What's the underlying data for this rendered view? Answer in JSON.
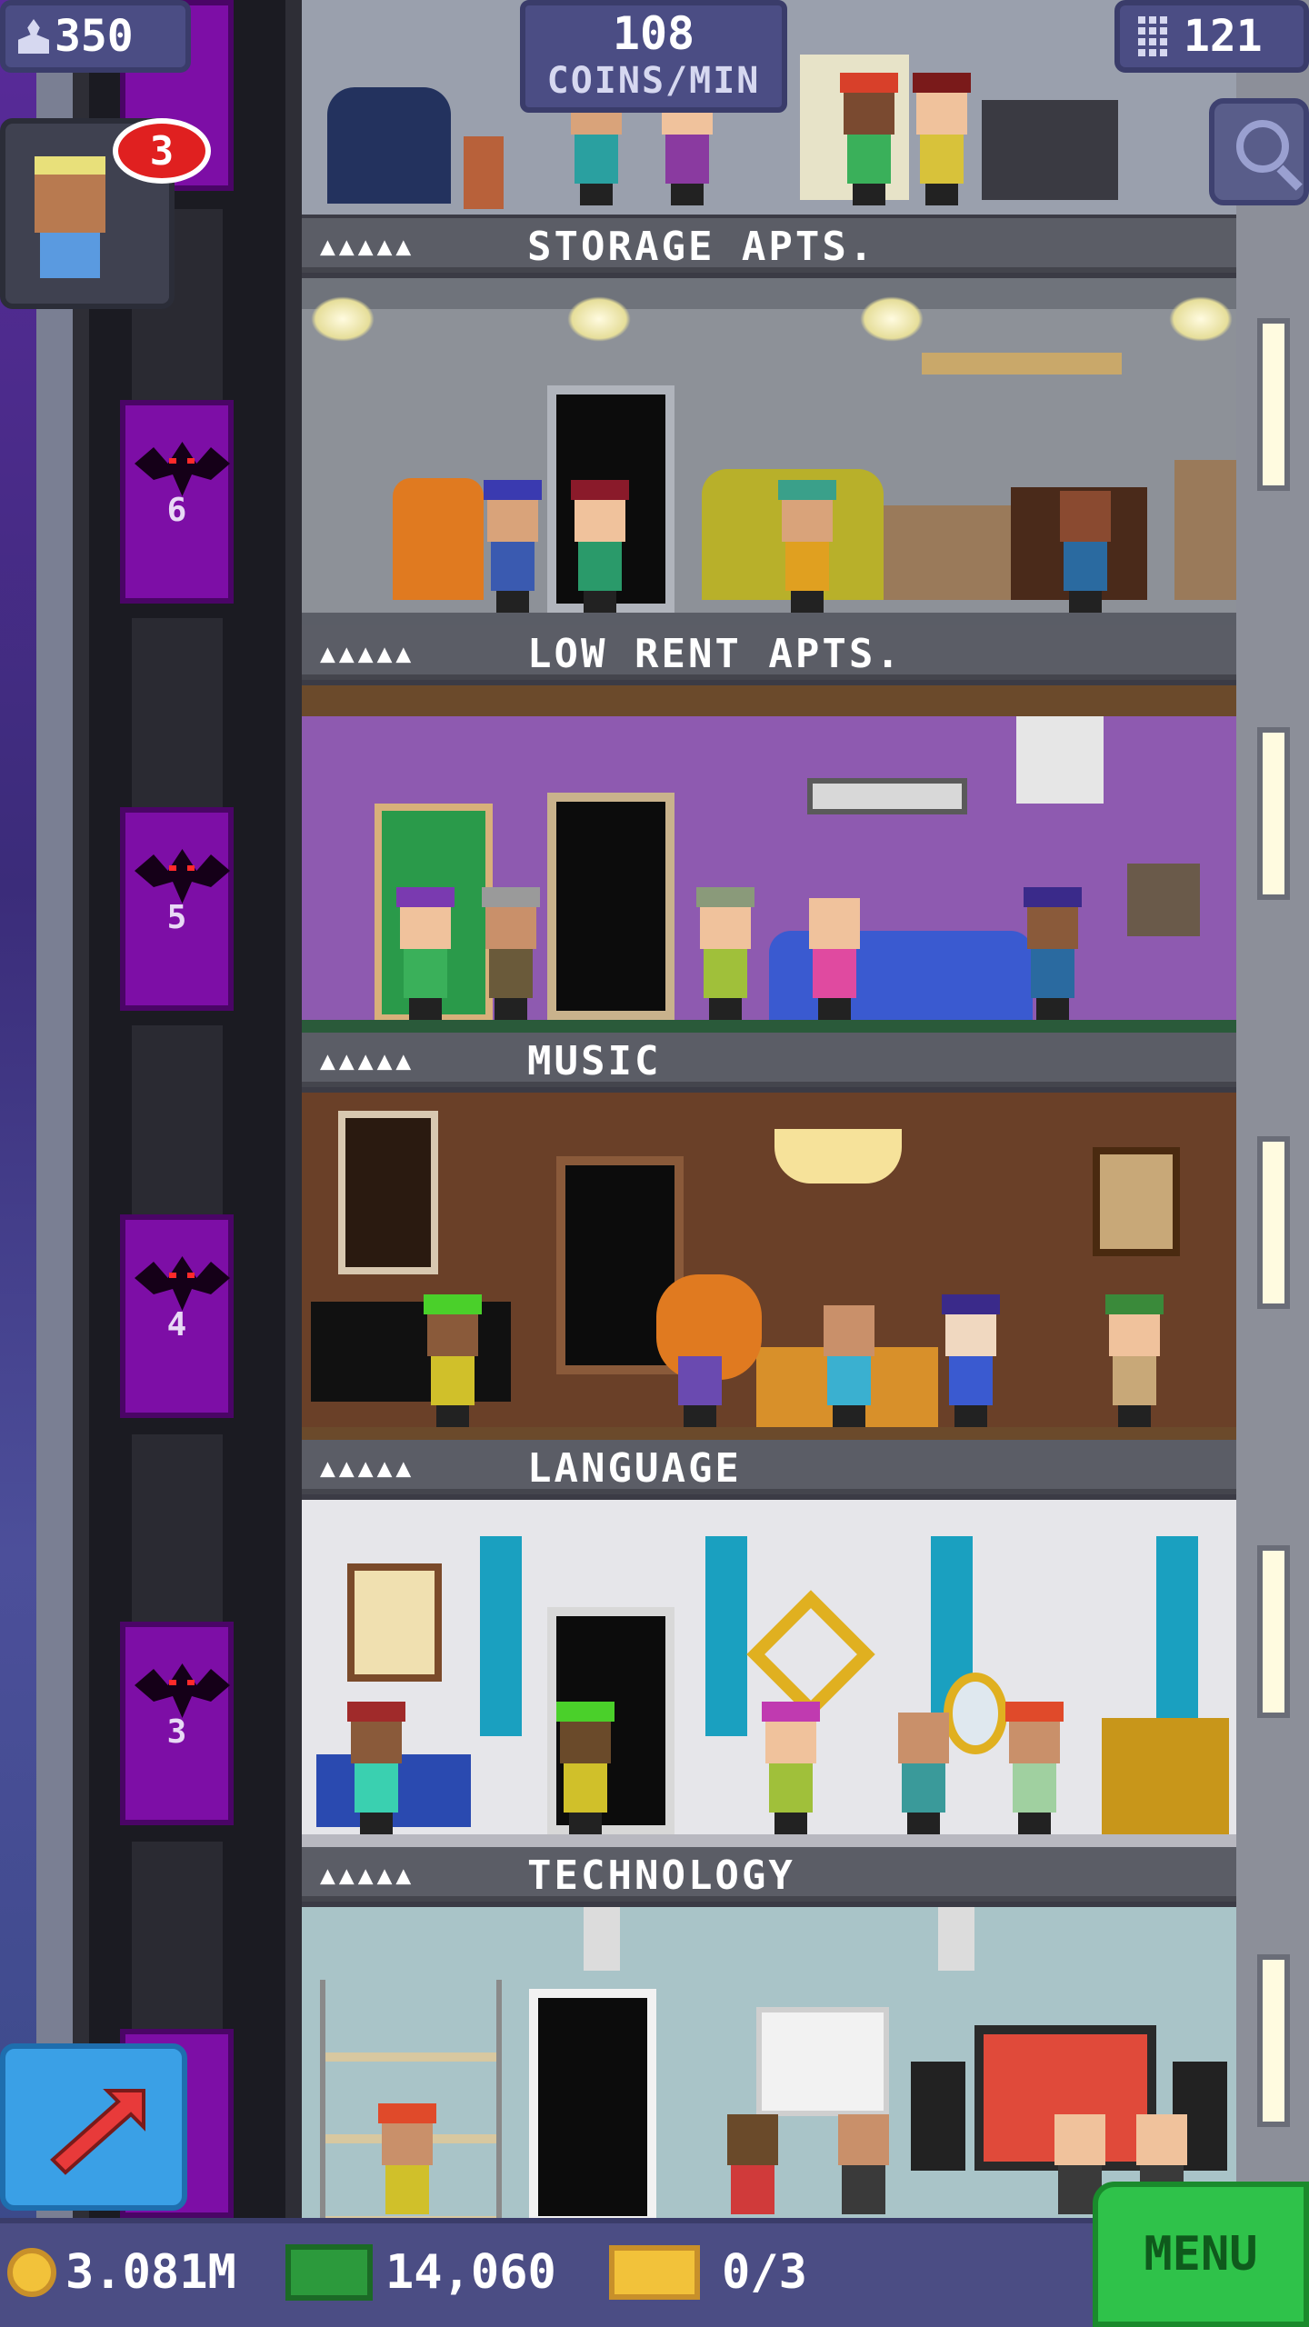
{
  "hud": {
    "population": "350",
    "coins_per_min_value": "108",
    "coins_per_min_unit": "COINS/MIN",
    "floor_count": "121",
    "visitor_badge_count": "3"
  },
  "floors": [
    {
      "name": "STORAGE APTS.",
      "stars": "▲▲▲▲▲"
    },
    {
      "name": "LOW RENT APTS.",
      "stars": "▲▲▲▲▲"
    },
    {
      "name": "MUSIC",
      "stars": "▲▲▲▲▲"
    },
    {
      "name": "LANGUAGE",
      "stars": "▲▲▲▲▲"
    },
    {
      "name": "TECHNOLOGY",
      "stars": "▲▲▲▲▲"
    }
  ],
  "elevator": {
    "labels": [
      "6",
      "5",
      "4",
      "3"
    ]
  },
  "bottom_bar": {
    "coins": "3.081M",
    "tower_bux": "14,060",
    "tickets": "0/3",
    "menu_label": "MENU"
  },
  "colors": {
    "hud_bg": "#4b4d84",
    "elevator": "#7d0ea6",
    "menu": "#2fc24a",
    "badge": "#e02020"
  },
  "icons": [
    "population-icon",
    "floors-icon",
    "search-icon",
    "arrow-up-right-icon",
    "coin-icon",
    "bux-icon",
    "ticket-icon",
    "bat-icon"
  ]
}
